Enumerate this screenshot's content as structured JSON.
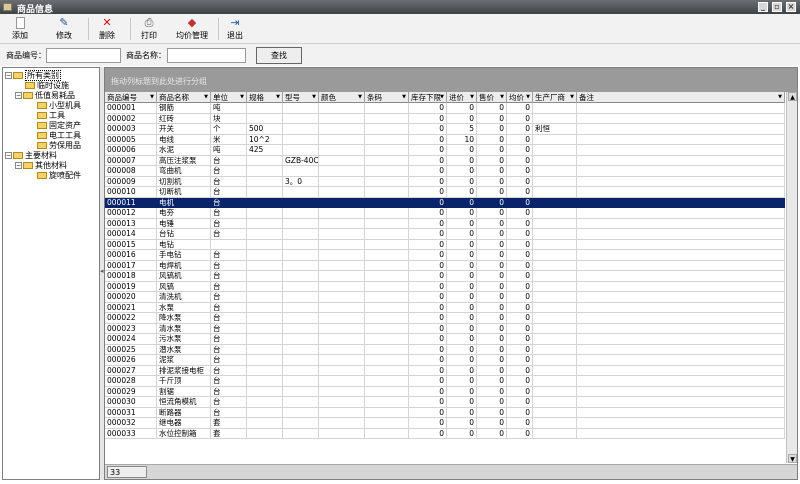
{
  "window": {
    "title": "商品信息"
  },
  "toolbar": {
    "add": "添加",
    "edit": "修改",
    "delete": "删除",
    "print": "打印",
    "price": "均价管理",
    "exit": "退出"
  },
  "search": {
    "code_label": "商品编号：",
    "name_label": "商品名称：",
    "button": "查找",
    "code_value": "",
    "name_value": ""
  },
  "tree": {
    "root": "所有类别",
    "nodes": [
      "临时设施",
      "低值易耗品",
      "小型机具",
      "工具",
      "固定资产",
      "电工工具",
      "劳保用品",
      "主要材料",
      "其他材料",
      "旋喷配件"
    ]
  },
  "grid": {
    "group_hint": "拖动列标题到此处进行分组",
    "columns": [
      "商品编号",
      "商品名称",
      "单位",
      "规格",
      "型号",
      "颜色",
      "条码",
      "库存下限",
      "进价",
      "售价",
      "均价",
      "生产厂商",
      "备注"
    ],
    "rows": [
      [
        "000001",
        "钢筋",
        "吨",
        "",
        "",
        "",
        "",
        "0",
        "0",
        "0",
        "0",
        "",
        ""
      ],
      [
        "000002",
        "红砖",
        "块",
        "",
        "",
        "",
        "",
        "0",
        "0",
        "0",
        "0",
        "",
        ""
      ],
      [
        "000003",
        "开关",
        "个",
        "500",
        "",
        "",
        "",
        "0",
        "5",
        "0",
        "0",
        "利恒",
        ""
      ],
      [
        "000005",
        "电线",
        "米",
        "10^2",
        "",
        "",
        "",
        "0",
        "10",
        "0",
        "0",
        "",
        ""
      ],
      [
        "000006",
        "水泥",
        "吨",
        "425",
        "",
        "",
        "",
        "0",
        "0",
        "0",
        "0",
        "",
        ""
      ],
      [
        "000007",
        "高压注浆泵",
        "台",
        "",
        "GZB-40C",
        "",
        "",
        "0",
        "0",
        "0",
        "0",
        "",
        ""
      ],
      [
        "000008",
        "弯曲机",
        "台",
        "",
        "",
        "",
        "",
        "0",
        "0",
        "0",
        "0",
        "",
        ""
      ],
      [
        "000009",
        "切割机",
        "台",
        "",
        "3。0",
        "",
        "",
        "0",
        "0",
        "0",
        "0",
        "",
        ""
      ],
      [
        "000010",
        "切断机",
        "台",
        "",
        "",
        "",
        "",
        "0",
        "0",
        "0",
        "0",
        "",
        ""
      ],
      [
        "000011",
        "电机",
        "台",
        "",
        "",
        "",
        "",
        "0",
        "0",
        "0",
        "0",
        "",
        ""
      ],
      [
        "000012",
        "电夯",
        "台",
        "",
        "",
        "",
        "",
        "0",
        "0",
        "0",
        "0",
        "",
        ""
      ],
      [
        "000013",
        "电锤",
        "台",
        "",
        "",
        "",
        "",
        "0",
        "0",
        "0",
        "0",
        "",
        ""
      ],
      [
        "000014",
        "台钻",
        "台",
        "",
        "",
        "",
        "",
        "0",
        "0",
        "0",
        "0",
        "",
        ""
      ],
      [
        "000015",
        "电钻",
        "",
        "",
        "",
        "",
        "",
        "0",
        "0",
        "0",
        "0",
        "",
        ""
      ],
      [
        "000016",
        "手电钻",
        "台",
        "",
        "",
        "",
        "",
        "0",
        "0",
        "0",
        "0",
        "",
        ""
      ],
      [
        "000017",
        "电焊机",
        "台",
        "",
        "",
        "",
        "",
        "0",
        "0",
        "0",
        "0",
        "",
        ""
      ],
      [
        "000018",
        "风镐机",
        "台",
        "",
        "",
        "",
        "",
        "0",
        "0",
        "0",
        "0",
        "",
        ""
      ],
      [
        "000019",
        "风镐",
        "台",
        "",
        "",
        "",
        "",
        "0",
        "0",
        "0",
        "0",
        "",
        ""
      ],
      [
        "000020",
        "清洗机",
        "台",
        "",
        "",
        "",
        "",
        "0",
        "0",
        "0",
        "0",
        "",
        ""
      ],
      [
        "000021",
        "水泵",
        "台",
        "",
        "",
        "",
        "",
        "0",
        "0",
        "0",
        "0",
        "",
        ""
      ],
      [
        "000022",
        "降水泵",
        "台",
        "",
        "",
        "",
        "",
        "0",
        "0",
        "0",
        "0",
        "",
        ""
      ],
      [
        "000023",
        "清水泵",
        "台",
        "",
        "",
        "",
        "",
        "0",
        "0",
        "0",
        "0",
        "",
        ""
      ],
      [
        "000024",
        "污水泵",
        "台",
        "",
        "",
        "",
        "",
        "0",
        "0",
        "0",
        "0",
        "",
        ""
      ],
      [
        "000025",
        "潜水泵",
        "台",
        "",
        "",
        "",
        "",
        "0",
        "0",
        "0",
        "0",
        "",
        ""
      ],
      [
        "000026",
        "泥浆",
        "台",
        "",
        "",
        "",
        "",
        "0",
        "0",
        "0",
        "0",
        "",
        ""
      ],
      [
        "000027",
        "排泥浆接电柜",
        "台",
        "",
        "",
        "",
        "",
        "0",
        "0",
        "0",
        "0",
        "",
        ""
      ],
      [
        "000028",
        "千斤顶",
        "台",
        "",
        "",
        "",
        "",
        "0",
        "0",
        "0",
        "0",
        "",
        ""
      ],
      [
        "000029",
        "割锯",
        "台",
        "",
        "",
        "",
        "",
        "0",
        "0",
        "0",
        "0",
        "",
        ""
      ],
      [
        "000030",
        "恒流角模机",
        "台",
        "",
        "",
        "",
        "",
        "0",
        "0",
        "0",
        "0",
        "",
        ""
      ],
      [
        "000031",
        "断路器",
        "台",
        "",
        "",
        "",
        "",
        "0",
        "0",
        "0",
        "0",
        "",
        ""
      ],
      [
        "000032",
        "继电器",
        "套",
        "",
        "",
        "",
        "",
        "0",
        "0",
        "0",
        "0",
        "",
        ""
      ],
      [
        "000033",
        "水位控制箱",
        "套",
        "",
        "",
        "",
        "",
        "0",
        "0",
        "0",
        "0",
        "",
        ""
      ]
    ],
    "selected_row": 9,
    "record_count": "33"
  },
  "colors": {
    "selection": "#0a246a",
    "titlebar": "#4a4e52"
  }
}
